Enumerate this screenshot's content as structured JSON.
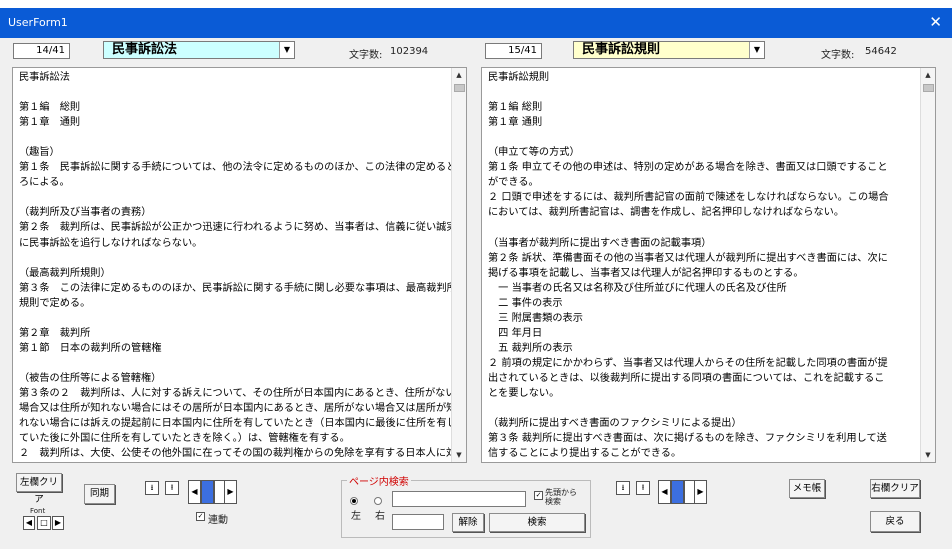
{
  "window": {
    "title": "UserForm1",
    "close": "✕"
  },
  "left": {
    "page": "14/41",
    "law": "民事訴訟法",
    "count_label": "文字数:",
    "count": "102394",
    "text": "民事訴訟法\n\n第１編　総則\n第１章　通則\n\n（趣旨）\n第１条　民事訴訟に関する手続については、他の法令に定めるもののほか、この法律の定めるとこ\nろによる。\n\n（裁判所及び当事者の責務）\n第２条　裁判所は、民事訴訟が公正かつ迅速に行われるように努め、当事者は、信義に従い誠実\nに民事訴訟を追行しなければならない。\n\n（最高裁判所規則）\n第３条　この法律に定めるもののほか、民事訴訟に関する手続に関し必要な事項は、最高裁判所\n規則で定める。\n\n第２章　裁判所\n第１節　日本の裁判所の管轄権\n\n（被告の住所等による管轄権）\n第３条の２　裁判所は、人に対する訴えについて、その住所が日本国内にあるとき、住所がない\n場合又は住所が知れない場合にはその居所が日本国内にあるとき、居所がない場合又は居所が知\nれない場合には訴えの提起前に日本国内に住所を有していたとき（日本国内に最後に住所を有し\nていた後に外国に住所を有していたときを除く。）は、管轄権を有する。\n２　裁判所は、大使、公使その他外国に在ってその国の裁判権からの免除を享有する日本人に対"
  },
  "right": {
    "page": "15/41",
    "law": "民事訴訟規則",
    "count_label": "文字数:",
    "count": "54642",
    "text": "民事訴訟規則\n\n第１編 総則\n第１章 通則\n\n（申立て等の方式）\n第１条 申立てその他の申述は、特別の定めがある場合を除き、書面又は口頭ですること\nができる。\n２ 口頭で申述をするには、裁判所書記官の面前で陳述をしなければならない。この場合\nにおいては、裁判所書記官は、調書を作成し、記名押印しなければならない。\n\n（当事者が裁判所に提出すべき書面の記載事項）\n第２条 訴状、準備書面その他の当事者又は代理人が裁判所に提出すべき書面には、次に\n掲げる事項を記載し、当事者又は代理人が記名押印するものとする。\n　一 当事者の氏名又は名称及び住所並びに代理人の氏名及び住所\n　二 事件の表示\n　三 附属書類の表示\n　四 年月日\n　五 裁判所の表示\n２ 前項の規定にかかわらず、当事者又は代理人からその住所を記載した同項の書面が提\n出されているときは、以後裁判所に提出する同項の書面については、これを記載するこ\nとを要しない。\n\n（裁判所に提出すべき書面のファクシミリによる提出）\n第３条 裁判所に提出すべき書面は、次に掲げるものを除き、ファクシミリを利用して送\n信することにより提出することができる。"
  },
  "controls": {
    "left_clear": "左欄クリア",
    "sync": "同期",
    "font_label": "Font",
    "link_label": "連動",
    "search_legend": "ページ内検索",
    "radio_left": "左",
    "radio_right": "右",
    "head_search": "先頭から\n検索",
    "reset": "解除",
    "search": "検索",
    "memo": "メモ帳",
    "right_clear": "右欄クリア",
    "back": "戻る"
  },
  "colors": {
    "left_combo": "#ccffff",
    "right_combo": "#ffffcc",
    "title": "#0a5bd6",
    "legend": "#d00000"
  }
}
